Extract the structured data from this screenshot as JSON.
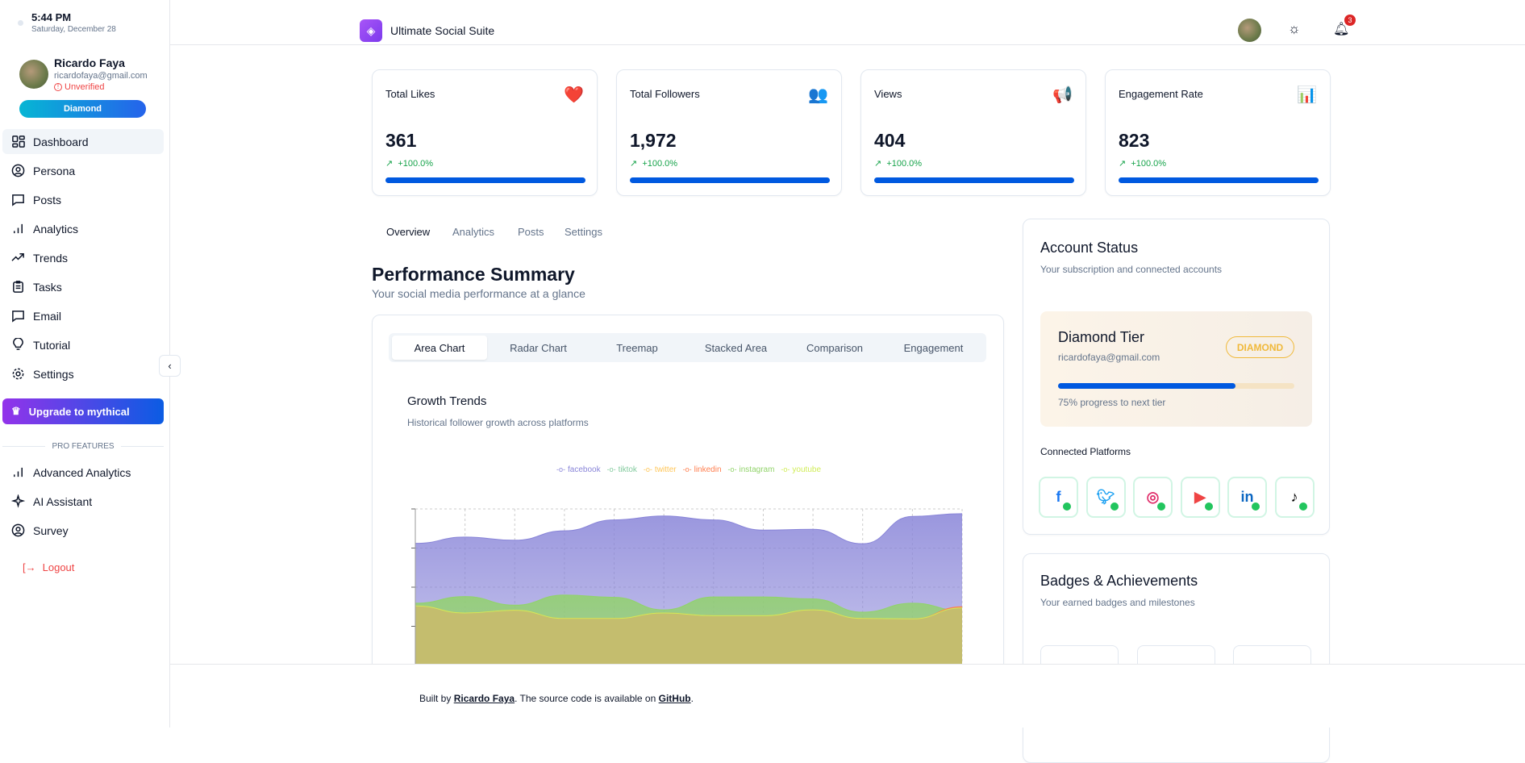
{
  "clock": {
    "time": "5:44 PM",
    "date": "Saturday, December 28"
  },
  "user": {
    "name": "Ricardo Faya",
    "email": "ricardofaya@gmail.com",
    "status": "Unverified",
    "tier": "Diamond"
  },
  "sidebar": {
    "items": [
      {
        "label": "Dashboard",
        "icon": "dashboard-icon"
      },
      {
        "label": "Persona",
        "icon": "user-circle-icon"
      },
      {
        "label": "Posts",
        "icon": "message-icon"
      },
      {
        "label": "Analytics",
        "icon": "bar-chart-icon"
      },
      {
        "label": "Trends",
        "icon": "trending-icon"
      },
      {
        "label": "Tasks",
        "icon": "clipboard-icon"
      },
      {
        "label": "Email",
        "icon": "message-icon"
      },
      {
        "label": "Tutorial",
        "icon": "lightbulb-icon"
      },
      {
        "label": "Settings",
        "icon": "gear-icon"
      }
    ],
    "upgrade": "Upgrade to mythical",
    "pro_heading": "PRO FEATURES",
    "pro_items": [
      {
        "label": "Advanced Analytics"
      },
      {
        "label": "AI Assistant"
      },
      {
        "label": "Survey"
      }
    ],
    "logout": "Logout"
  },
  "header": {
    "title": "Ultimate Social Suite",
    "notifications": "3"
  },
  "stats": [
    {
      "label": "Total Likes",
      "value": "361",
      "change": "+100.0%",
      "icon": "❤️",
      "progress": 100
    },
    {
      "label": "Total Followers",
      "value": "1,972",
      "change": "+100.0%",
      "icon": "👥",
      "progress": 100
    },
    {
      "label": "Views",
      "value": "404",
      "change": "+100.0%",
      "icon": "📢",
      "progress": 100
    },
    {
      "label": "Engagement Rate",
      "value": "823",
      "change": "+100.0%",
      "icon": "📊",
      "progress": 100
    }
  ],
  "tabs": [
    "Overview",
    "Analytics",
    "Posts",
    "Settings"
  ],
  "summary": {
    "title": "Performance Summary",
    "subtitle": "Your social media performance at a glance"
  },
  "chart_tabs": [
    "Area Chart",
    "Radar Chart",
    "Treemap",
    "Stacked Area",
    "Comparison",
    "Engagement"
  ],
  "chart_data": {
    "type": "area",
    "title": "Growth Trends",
    "subtitle": "Historical follower growth across platforms",
    "legend_position": "top",
    "grid": true,
    "series": [
      {
        "name": "facebook",
        "color": "#8884d8",
        "values": [
          3.12,
          3.28,
          3.2,
          3.44,
          3.72,
          3.82,
          3.72,
          3.46,
          3.48,
          3.11,
          3.81,
          3.88
        ]
      },
      {
        "name": "tiktok",
        "color": "#82ca9d",
        "values": []
      },
      {
        "name": "twitter",
        "color": "#ffc658",
        "values": []
      },
      {
        "name": "linkedin",
        "color": "#ff7f50",
        "values": [
          1.52,
          1.34,
          1.41,
          1.2,
          1.2,
          1.34,
          1.27,
          1.27,
          1.42,
          1.2,
          1.19,
          1.5
        ]
      },
      {
        "name": "instagram",
        "color": "#91d36a",
        "values": [
          1.59,
          1.76,
          1.54,
          1.8,
          1.74,
          1.42,
          1.75,
          1.75,
          1.7,
          1.36,
          1.59,
          1.4
        ]
      },
      {
        "name": "youtube",
        "color": "#d0ed57",
        "values": [
          1.52,
          1.34,
          1.41,
          1.2,
          1.2,
          1.34,
          1.27,
          1.27,
          1.42,
          1.2,
          1.19,
          1.47
        ]
      }
    ]
  },
  "account": {
    "title": "Account Status",
    "subtitle": "Your subscription and connected accounts",
    "tier_title": "Diamond Tier",
    "email": "ricardofaya@gmail.com",
    "badge": "DIAMOND",
    "progress": 75,
    "progress_text": "75% progress to next tier",
    "platforms_title": "Connected Platforms",
    "platforms": [
      "facebook",
      "twitter",
      "instagram",
      "youtube",
      "linkedin",
      "tiktok"
    ]
  },
  "badges": {
    "title": "Badges & Achievements",
    "subtitle": "Your earned badges and milestones"
  },
  "footer": {
    "prefix": "Built by ",
    "author": "Ricardo Faya",
    "middle": ". The source code is available on ",
    "link": "GitHub",
    "suffix": "."
  },
  "colors": {
    "accent": "#0059e0",
    "upgrade_from": "#9333ea",
    "upgrade_to": "#0b5ce3",
    "danger": "#ef4444",
    "success": "#16a34a"
  }
}
